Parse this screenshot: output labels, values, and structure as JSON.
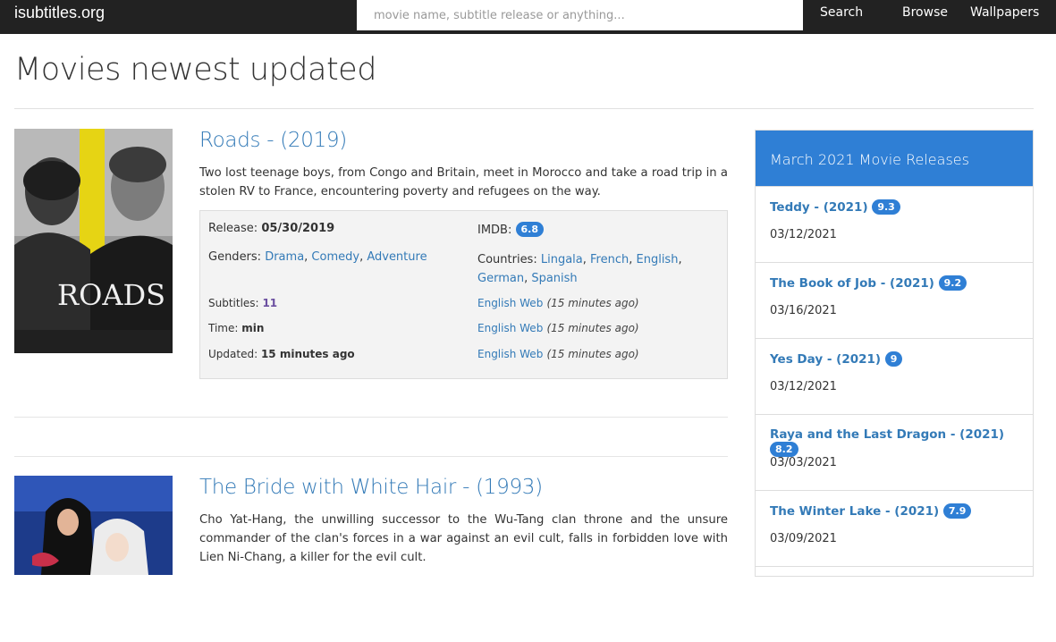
{
  "header": {
    "brand": "isubtitles.org",
    "search_placeholder": "movie name, subtitle release or anything...",
    "nav": [
      "Search",
      "Browse",
      "Wallpapers"
    ]
  },
  "page_title": "Movies newest updated",
  "movies": [
    {
      "title": "Roads",
      "year": "- (2019)",
      "description": "Two lost teenage boys, from Congo and Britain, meet in Morocco and take a road trip in a stolen RV to France, encountering poverty and refugees on the way.",
      "release_label": "Release:",
      "release": "05/30/2019",
      "imdb_label": "IMDB:",
      "imdb": "6.8",
      "genders_label": "Genders:",
      "genders": [
        "Drama",
        "Comedy",
        "Adventure"
      ],
      "countries_label": "Countries:",
      "countries": [
        "Lingala",
        "French",
        "English",
        "German",
        "Spanish"
      ],
      "subtitles_label": "Subtitles:",
      "subtitles": "11",
      "time_label": "Time:",
      "time": "min",
      "updated_label": "Updated:",
      "updated": "15 minutes ago",
      "subtitle_links": [
        {
          "label": "English Web",
          "time": "(15 minutes ago)"
        },
        {
          "label": "English Web",
          "time": "(15 minutes ago)"
        },
        {
          "label": "English Web",
          "time": "(15 minutes ago)"
        }
      ],
      "poster_text": "ROADS"
    },
    {
      "title": "The Bride with White Hair",
      "year": "- (1993)",
      "description": "Cho Yat-Hang, the unwilling successor to the Wu-Tang clan throne and the unsure commander of the clan's forces in a war against an evil cult, falls in forbidden love with Lien Ni-Chang, a killer for the evil cult."
    }
  ],
  "sidebar": {
    "title": "March 2021 Movie Releases",
    "items": [
      {
        "title": "Teddy",
        "year": "- (2021)",
        "rating": "9.3",
        "date": "03/12/2021"
      },
      {
        "title": "The Book of Job",
        "year": "- (2021)",
        "rating": "9.2",
        "date": "03/16/2021"
      },
      {
        "title": "Yes Day",
        "year": "- (2021)",
        "rating": "9",
        "date": "03/12/2021"
      },
      {
        "title": "Raya and the Last Dragon",
        "year": "- (2021)",
        "rating": "8.2",
        "date": "03/03/2021"
      },
      {
        "title": "The Winter Lake",
        "year": "- (2021)",
        "rating": "7.9",
        "date": "03/09/2021"
      }
    ]
  },
  "colors": {
    "topbar": "#222222",
    "link": "#337ab7",
    "accent": "#2f7fd5",
    "panel": "#f3f3f3"
  }
}
